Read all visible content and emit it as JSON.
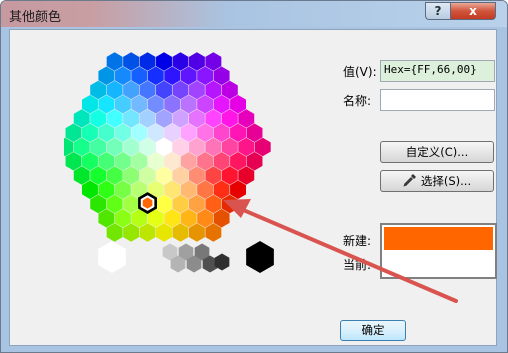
{
  "window": {
    "title": "其他颜色"
  },
  "caption_buttons": {
    "help": "?",
    "close": "x"
  },
  "value": {
    "label": "值(V):",
    "hex": "Hex={FF,66,00}"
  },
  "name": {
    "label": "名称:",
    "value": ""
  },
  "buttons": {
    "custom": "自定义(C)...",
    "pick": "选择(S)...",
    "ok": "确定"
  },
  "compare": {
    "new_label": "新建:",
    "current_label": "当前:",
    "new_color": "#ff6600",
    "current_color": "#ffffff"
  },
  "selected_color": "#ff6600",
  "icons": {
    "eyedropper": "eyedropper-icon"
  }
}
